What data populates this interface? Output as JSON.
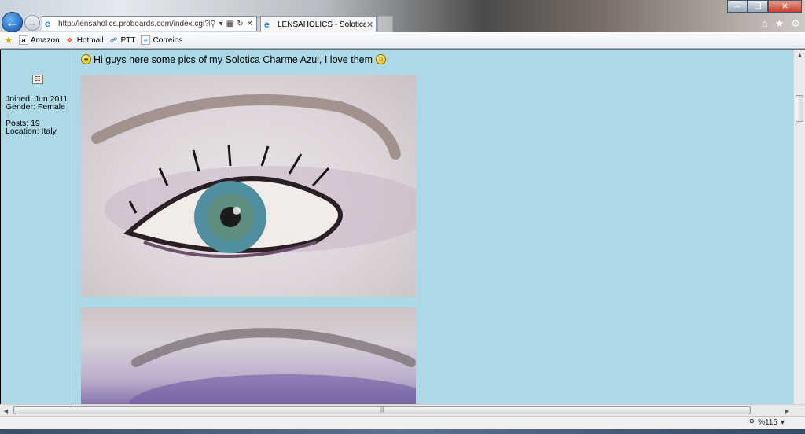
{
  "browser": {
    "address_url": "http://lensaholics.proboards.com/index.cgi?boa",
    "tab_title": "LENSAHOLICS - Solotica hi...",
    "favorites": [
      {
        "label": "Amazon",
        "icon": "amazon-icon"
      },
      {
        "label": "Hotmail",
        "icon": "windows-icon"
      },
      {
        "label": "PTT",
        "icon": "ptt-icon"
      },
      {
        "label": "Correios",
        "icon": "ie-page-icon"
      }
    ],
    "zoom": "%115"
  },
  "profile": {
    "joined": "Joined: Jun 2011",
    "gender": "Gender: Female",
    "gender_symbol": "♀",
    "posts": "Posts: 19",
    "location": "Location: Italy"
  },
  "post": {
    "text": "Hi guys here some pics of my Solotica Charme Azul, I love them"
  },
  "colors": {
    "page_bg": "#add8e6",
    "accent_blue": "#2b74c7"
  }
}
